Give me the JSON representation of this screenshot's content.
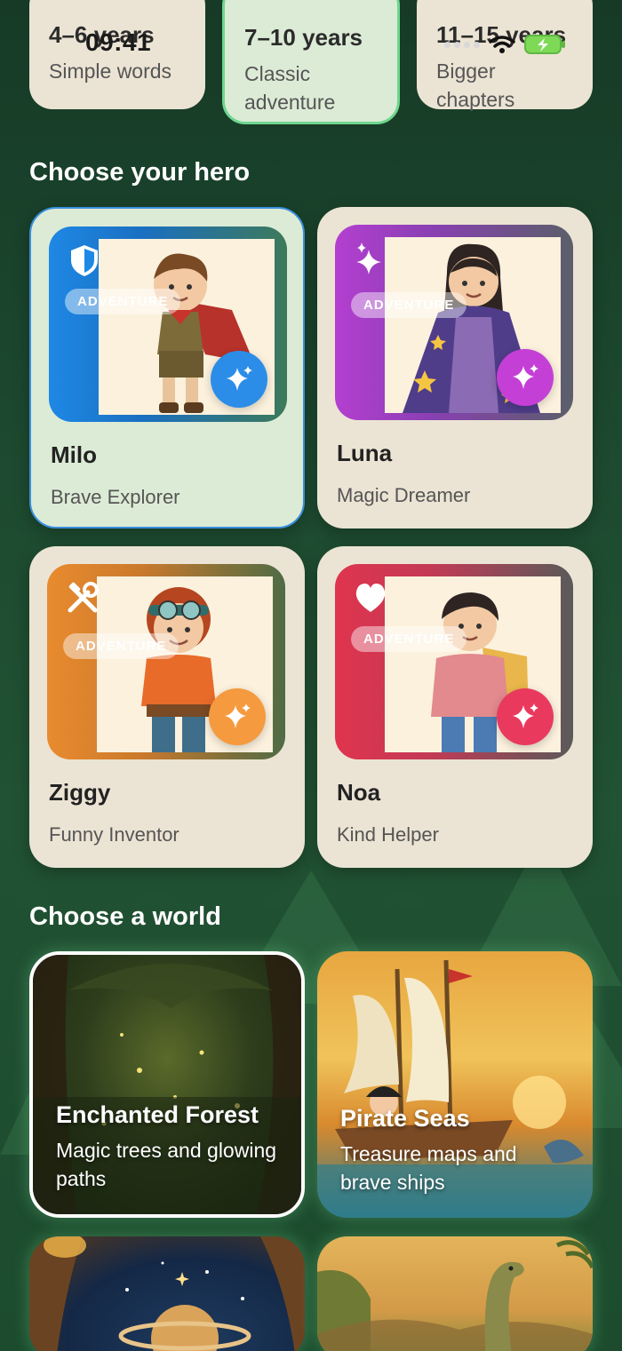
{
  "status_bar": {
    "time": "09:41"
  },
  "age_groups": [
    {
      "title": "4–6 years",
      "subtitle": "Simple words",
      "selected": false
    },
    {
      "title": "7–10 years",
      "subtitle": "Classic adventure",
      "selected": true
    },
    {
      "title": "11–15 years",
      "subtitle": "Bigger chapters",
      "selected": false
    }
  ],
  "heroes_section": {
    "title": "Choose your hero"
  },
  "heroes": [
    {
      "name": "Milo",
      "role": "Brave Explorer",
      "badge": "ADVENTURE",
      "icon": "shield-icon",
      "accent": "#1e88e5",
      "selected": true
    },
    {
      "name": "Luna",
      "role": "Magic Dreamer",
      "badge": "ADVENTURE",
      "icon": "sparkles-icon",
      "accent": "#a63fc9",
      "selected": false
    },
    {
      "name": "Ziggy",
      "role": "Funny Inventor",
      "badge": "ADVENTURE",
      "icon": "tools-icon",
      "accent": "#e98b2e",
      "selected": false
    },
    {
      "name": "Noa",
      "role": "Kind Helper",
      "badge": "ADVENTURE",
      "icon": "heart-icon",
      "accent": "#e0344e",
      "selected": false
    }
  ],
  "worlds_section": {
    "title": "Choose a world"
  },
  "worlds": [
    {
      "title": "Enchanted Forest",
      "description": "Magic trees and glowing paths",
      "selected": true
    },
    {
      "title": "Pirate Seas",
      "description": "Treasure maps and brave ships",
      "selected": false
    },
    {
      "title": "",
      "description": "",
      "selected": false
    },
    {
      "title": "",
      "description": "",
      "selected": false
    }
  ]
}
